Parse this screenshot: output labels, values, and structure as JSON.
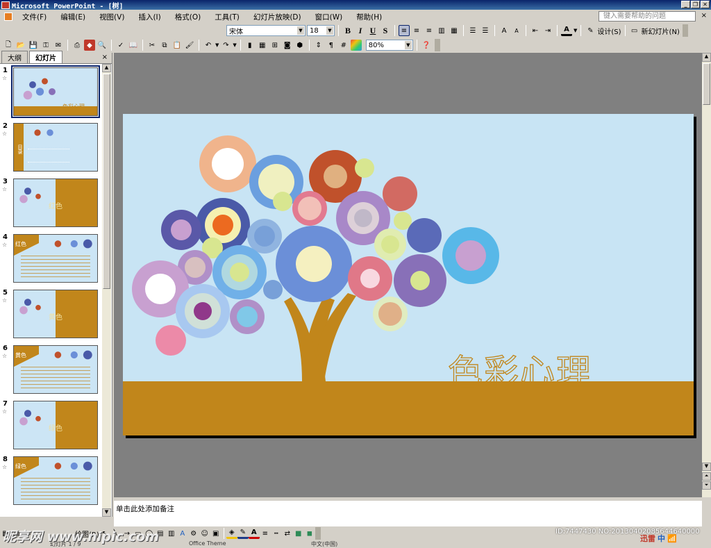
{
  "window": {
    "title": "Microsoft PowerPoint - [树]"
  },
  "menu": {
    "items": [
      "文件(F)",
      "编辑(E)",
      "视图(V)",
      "插入(I)",
      "格式(O)",
      "工具(T)",
      "幻灯片放映(D)",
      "窗口(W)",
      "帮助(H)"
    ],
    "help_placeholder": "键入需要帮助的问题",
    "help_close": "×"
  },
  "format_toolbar": {
    "font": "宋体",
    "size": "18",
    "bold": "B",
    "italic": "I",
    "underline": "U",
    "shadow": "S",
    "design_label": "设计(S)",
    "new_slide_label": "新幻灯片(N)"
  },
  "standard_toolbar": {
    "zoom": "80%"
  },
  "panel": {
    "tabs": [
      "大纲",
      "幻灯片"
    ],
    "active_tab": "幻灯片",
    "close": "×"
  },
  "thumbnails": [
    {
      "num": "1",
      "label": "色彩心理",
      "type": "title"
    },
    {
      "num": "2",
      "label": "目录",
      "type": "toc"
    },
    {
      "num": "3",
      "label": "红色",
      "type": "section"
    },
    {
      "num": "4",
      "label": "红色",
      "type": "text"
    },
    {
      "num": "5",
      "label": "黄色",
      "type": "section"
    },
    {
      "num": "6",
      "label": "黄色",
      "type": "text"
    },
    {
      "num": "7",
      "label": "绿色",
      "type": "section"
    },
    {
      "num": "8",
      "label": "绿色",
      "type": "text"
    }
  ],
  "slide": {
    "title": "色彩心理",
    "bg": "#c8e4f4",
    "ground": "#c1861b",
    "trunk": "#c1861b"
  },
  "notes": {
    "placeholder": "单击此处添加备注"
  },
  "drawing_toolbar": {
    "label": "绘图(R)"
  },
  "status": {
    "slide": "幻灯片 1 / 9",
    "theme": "Office Theme",
    "language": "中文(中国)"
  },
  "overlay": {
    "watermark": "昵享网 www.nipic.com",
    "id_text": "ID:7447430 NO:20130402085644640000",
    "ime_brand": "迅雷",
    "ime_lang": "中"
  }
}
